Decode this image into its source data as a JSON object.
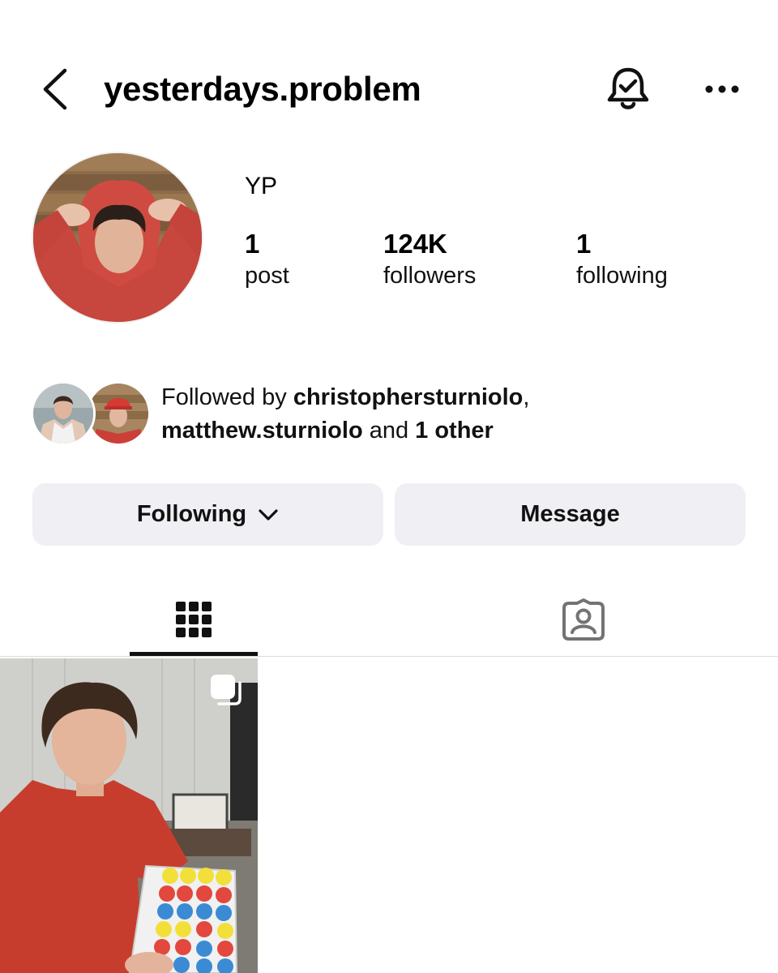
{
  "header": {
    "username": "yesterdays.problem",
    "back_icon": "chevron-left-icon",
    "bell_icon": "bell-check-icon",
    "more_icon": "more-horizontal-icon"
  },
  "profile": {
    "display_name": "YP",
    "stats": {
      "posts": {
        "value": "1",
        "label": "post"
      },
      "followers": {
        "value": "124K",
        "label": "followers"
      },
      "following": {
        "value": "1",
        "label": "following"
      }
    }
  },
  "followed_by": {
    "prefix": "Followed by ",
    "user1": "christophersturniolo",
    "comma": ",",
    "user2": "matthew.sturniolo",
    "and": " and ",
    "others": "1 other"
  },
  "actions": {
    "following_label": "Following",
    "message_label": "Message"
  },
  "tabs": {
    "grid_icon": "grid-icon",
    "tagged_icon": "tagged-person-icon"
  },
  "colors": {
    "button_bg": "#efeff4",
    "divider": "#dbdbdb",
    "tab_icon_inactive": "#737373"
  }
}
